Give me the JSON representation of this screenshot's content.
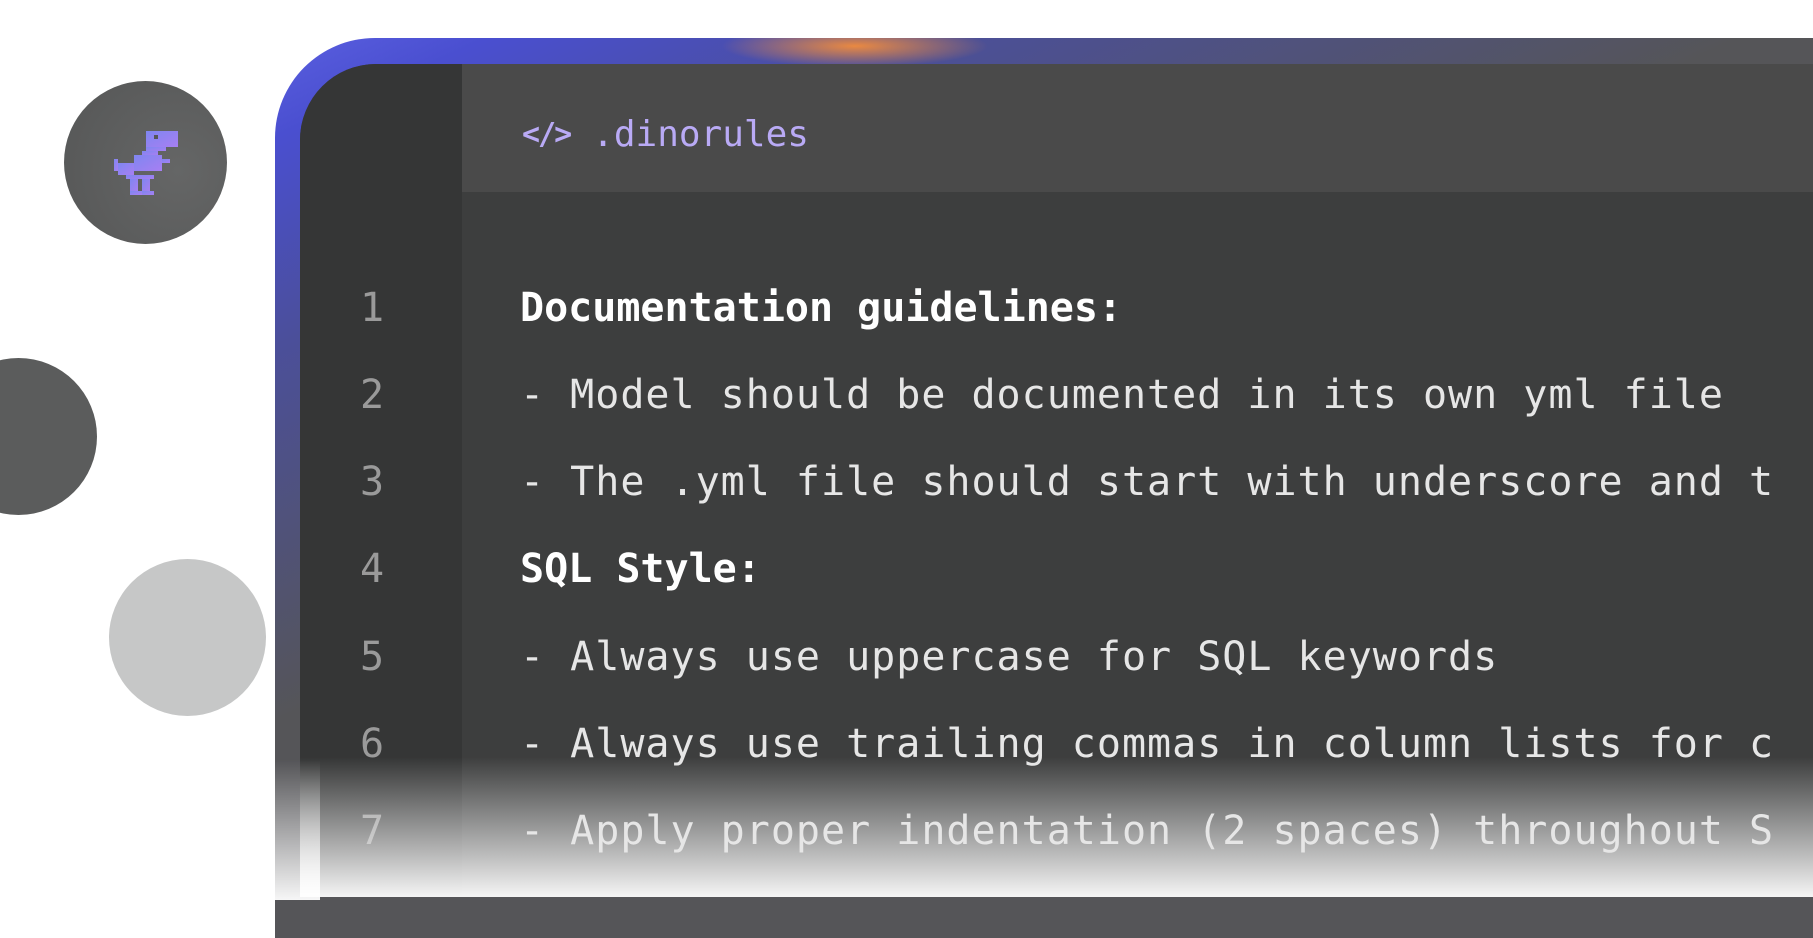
{
  "editor": {
    "file_tab": {
      "icon": "code-icon",
      "icon_glyph": "</>",
      "name": ".dinorules"
    },
    "lines": [
      {
        "number": "1",
        "text": "Documentation guidelines:",
        "style": "heading"
      },
      {
        "number": "2",
        "text": "- Model should be documented in its own yml file",
        "style": "normal"
      },
      {
        "number": "3",
        "text": "- The .yml file should start with underscore and t",
        "style": "normal"
      },
      {
        "number": "4",
        "text": "SQL Style:",
        "style": "heading"
      },
      {
        "number": "5",
        "text": "- Always use uppercase for SQL keywords",
        "style": "normal"
      },
      {
        "number": "6",
        "text": "- Always use trailing commas in column lists for c",
        "style": "normal"
      },
      {
        "number": "7",
        "text": "- Apply proper indentation (2 spaces) throughout S",
        "style": "normal"
      }
    ]
  },
  "avatar": {
    "icon": "dino-icon"
  },
  "colors": {
    "accent": "#b9aaf5",
    "editor_bg": "#3d3e3e",
    "gutter_bg": "#353636",
    "tabbar_bg": "#4a4a4a",
    "frame_gradient_start": "#5a5fe0",
    "frame_highlight": "#f28c3c"
  }
}
